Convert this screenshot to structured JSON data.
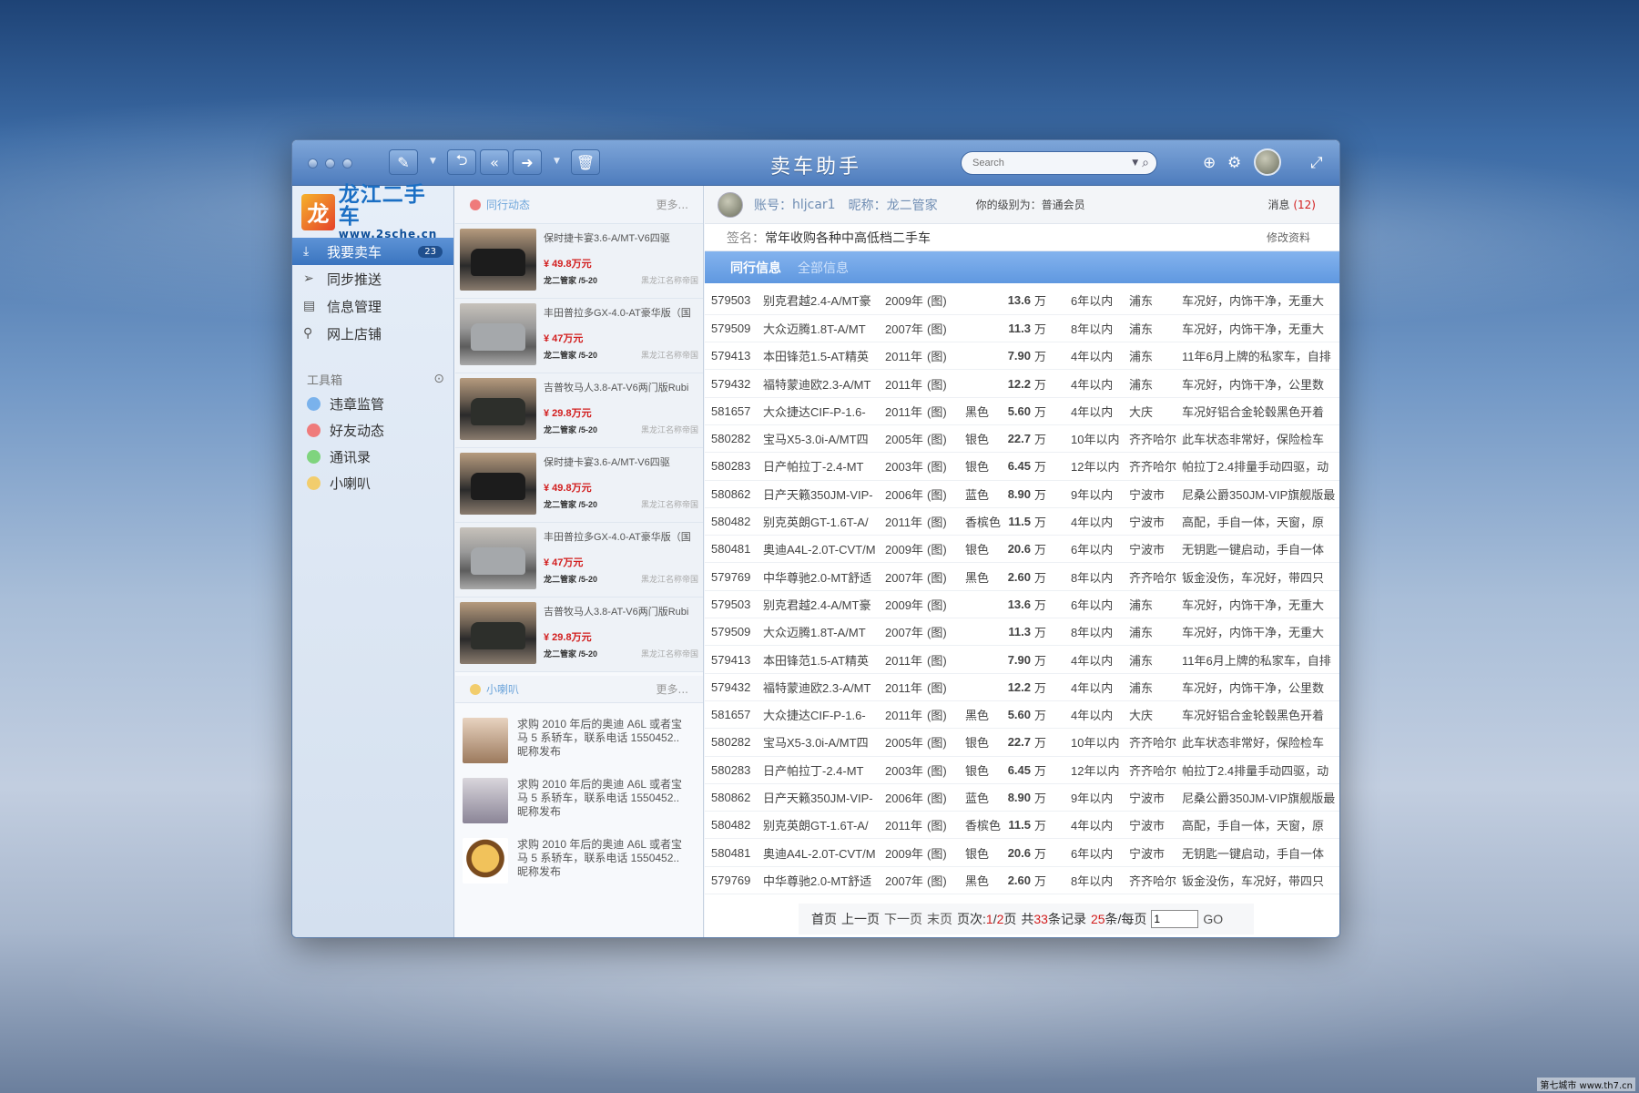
{
  "window": {
    "title": "卖车助手"
  },
  "search": {
    "placeholder": "Search"
  },
  "sidebar": {
    "logo": {
      "cn": "龙江二手车",
      "url": "www.2sche.cn"
    },
    "items": [
      {
        "label": "我要卖车",
        "badge": "23",
        "icon": "download-icon"
      },
      {
        "label": "同步推送",
        "icon": "send-icon"
      },
      {
        "label": "信息管理",
        "icon": "document-icon"
      },
      {
        "label": "网上店铺",
        "icon": "paperclip-icon"
      }
    ],
    "toolbox_label": "工具箱",
    "tools": [
      {
        "label": "违章监管",
        "color": "#7ab2ec"
      },
      {
        "label": "好友动态",
        "color": "#ef7b7b"
      },
      {
        "label": "通讯录",
        "color": "#7fd47e"
      },
      {
        "label": "小喇叭",
        "color": "#f2cd6d"
      }
    ]
  },
  "feed": {
    "header": "同行动态",
    "more": "更多...",
    "cars": [
      {
        "title": "保时捷卡宴3.6-A/MT-V6四驱",
        "price": "¥ 49.8万元",
        "who": "龙二管家 /5-20",
        "shop": "黑龙江名称帝国"
      },
      {
        "title": "丰田普拉多GX-4.0-AT豪华版（国",
        "price": "¥ 47万元",
        "who": "龙二管家 /5-20",
        "shop": "黑龙江名称帝国"
      },
      {
        "title": "吉普牧马人3.8-AT-V6两门版Rubi",
        "price": "¥ 29.8万元",
        "who": "龙二管家 /5-20",
        "shop": "黑龙江名称帝国"
      },
      {
        "title": "保时捷卡宴3.6-A/MT-V6四驱",
        "price": "¥ 49.8万元",
        "who": "龙二管家 /5-20",
        "shop": "黑龙江名称帝国"
      },
      {
        "title": "丰田普拉多GX-4.0-AT豪华版（国",
        "price": "¥ 47万元",
        "who": "龙二管家 /5-20",
        "shop": "黑龙江名称帝国"
      },
      {
        "title": "吉普牧马人3.8-AT-V6两门版Rubi",
        "price": "¥ 29.8万元",
        "who": "龙二管家 /5-20",
        "shop": "黑龙江名称帝国"
      }
    ]
  },
  "horn": {
    "header": "小喇叭",
    "more": "更多...",
    "posts": [
      {
        "l1": "求购 2010 年后的奥迪 A6L 或者宝",
        "l2": "马 5 系轿车，联系电话 1550452..",
        "l3": "昵称发布"
      },
      {
        "l1": "求购 2010 年后的奥迪 A6L 或者宝",
        "l2": "马 5 系轿车，联系电话 1550452..",
        "l3": "昵称发布"
      },
      {
        "l1": "求购 2010 年后的奥迪 A6L 或者宝",
        "l2": "马 5 系轿车，联系电话 1550452..",
        "l3": "昵称发布"
      }
    ]
  },
  "account": {
    "account_label": "账号：",
    "account": "hljcar1",
    "nick_label": "昵称：",
    "nick": "龙二管家",
    "level": "你的级别为：普通会员",
    "msg_label": "消息",
    "msg_count": "(12)",
    "sign_label": "签名：",
    "sign": "常年收购各种中高低档二手车",
    "edit": "修改资料"
  },
  "tabs": [
    "同行信息",
    "全部信息"
  ],
  "listings": [
    [
      "579503",
      "别克君越2.4-A/MT豪",
      "2009年",
      "(图)",
      "",
      "13.6",
      "万",
      "6年以内",
      "浦东",
      "车况好，内饰干净，无重大"
    ],
    [
      "579509",
      "大众迈腾1.8T-A/MT",
      "2007年",
      "(图)",
      "",
      "11.3",
      "万",
      "8年以内",
      "浦东",
      "车况好，内饰干净，无重大"
    ],
    [
      "579413",
      "本田锋范1.5-AT精英",
      "2011年",
      "(图)",
      "",
      "7.90",
      "万",
      "4年以内",
      "浦东",
      "11年6月上牌的私家车，自排"
    ],
    [
      "579432",
      "福特蒙迪欧2.3-A/MT",
      "2011年",
      "(图)",
      "",
      "12.2",
      "万",
      "4年以内",
      "浦东",
      "车况好，内饰干净，公里数"
    ],
    [
      "581657",
      "大众捷达CIF-P-1.6-",
      "2011年",
      "(图)",
      "黑色",
      "5.60",
      "万",
      "4年以内",
      "大庆",
      "车况好铝合金轮毂黑色开着"
    ],
    [
      "580282",
      "宝马X5-3.0i-A/MT四",
      "2005年",
      "(图)",
      "银色",
      "22.7",
      "万",
      "10年以内",
      "齐齐哈尔",
      "此车状态非常好，保险检车"
    ],
    [
      "580283",
      "日产帕拉丁-2.4-MT",
      "2003年",
      "(图)",
      "银色",
      "6.45",
      "万",
      "12年以内",
      "齐齐哈尔",
      "帕拉丁2.4排量手动四驱，动"
    ],
    [
      "580862",
      "日产天籁350JM-VIP-",
      "2006年",
      "(图)",
      "蓝色",
      "8.90",
      "万",
      "9年以内",
      "宁波市",
      "尼桑公爵350JM-VIP旗舰版最"
    ],
    [
      "580482",
      "别克英朗GT-1.6T-A/",
      "2011年",
      "(图)",
      "香槟色",
      "11.5",
      "万",
      "4年以内",
      "宁波市",
      "高配，手自一体，天窗，原"
    ],
    [
      "580481",
      "奥迪A4L-2.0T-CVT/M",
      "2009年",
      "(图)",
      "银色",
      "20.6",
      "万",
      "6年以内",
      "宁波市",
      "无钥匙一键启动，手自一体"
    ],
    [
      "579769",
      "中华尊驰2.0-MT舒适",
      "2007年",
      "(图)",
      "黑色",
      "2.60",
      "万",
      "8年以内",
      "齐齐哈尔",
      "钣金没伤，车况好，带四只"
    ],
    [
      "579503",
      "别克君越2.4-A/MT豪",
      "2009年",
      "(图)",
      "",
      "13.6",
      "万",
      "6年以内",
      "浦东",
      "车况好，内饰干净，无重大"
    ],
    [
      "579509",
      "大众迈腾1.8T-A/MT",
      "2007年",
      "(图)",
      "",
      "11.3",
      "万",
      "8年以内",
      "浦东",
      "车况好，内饰干净，无重大"
    ],
    [
      "579413",
      "本田锋范1.5-AT精英",
      "2011年",
      "(图)",
      "",
      "7.90",
      "万",
      "4年以内",
      "浦东",
      "11年6月上牌的私家车，自排"
    ],
    [
      "579432",
      "福特蒙迪欧2.3-A/MT",
      "2011年",
      "(图)",
      "",
      "12.2",
      "万",
      "4年以内",
      "浦东",
      "车况好，内饰干净，公里数"
    ],
    [
      "581657",
      "大众捷达CIF-P-1.6-",
      "2011年",
      "(图)",
      "黑色",
      "5.60",
      "万",
      "4年以内",
      "大庆",
      "车况好铝合金轮毂黑色开着"
    ],
    [
      "580282",
      "宝马X5-3.0i-A/MT四",
      "2005年",
      "(图)",
      "银色",
      "22.7",
      "万",
      "10年以内",
      "齐齐哈尔",
      "此车状态非常好，保险检车"
    ],
    [
      "580283",
      "日产帕拉丁-2.4-MT",
      "2003年",
      "(图)",
      "银色",
      "6.45",
      "万",
      "12年以内",
      "齐齐哈尔",
      "帕拉丁2.4排量手动四驱，动"
    ],
    [
      "580862",
      "日产天籁350JM-VIP-",
      "2006年",
      "(图)",
      "蓝色",
      "8.90",
      "万",
      "9年以内",
      "宁波市",
      "尼桑公爵350JM-VIP旗舰版最"
    ],
    [
      "580482",
      "别克英朗GT-1.6T-A/",
      "2011年",
      "(图)",
      "香槟色",
      "11.5",
      "万",
      "4年以内",
      "宁波市",
      "高配，手自一体，天窗，原"
    ],
    [
      "580481",
      "奥迪A4L-2.0T-CVT/M",
      "2009年",
      "(图)",
      "银色",
      "20.6",
      "万",
      "6年以内",
      "宁波市",
      "无钥匙一键启动，手自一体"
    ],
    [
      "579769",
      "中华尊驰2.0-MT舒适",
      "2007年",
      "(图)",
      "黑色",
      "2.60",
      "万",
      "8年以内",
      "齐齐哈尔",
      "钣金没伤，车况好，带四只"
    ]
  ],
  "pager": {
    "first": "首页",
    "prev": "上一页",
    "next": "下一页",
    "last": "末页",
    "page_label": "页次:",
    "page_cur": "1",
    "page_sep": "/",
    "page_total": "2",
    "page_unit": "页",
    "total_prefix": "共",
    "total": "33",
    "total_suffix": "条记录",
    "per_page": "25",
    "per_page_suffix": "条/每页",
    "input_value": "1",
    "go": "GO"
  },
  "watermark": "第七城市 www.th7.cn"
}
